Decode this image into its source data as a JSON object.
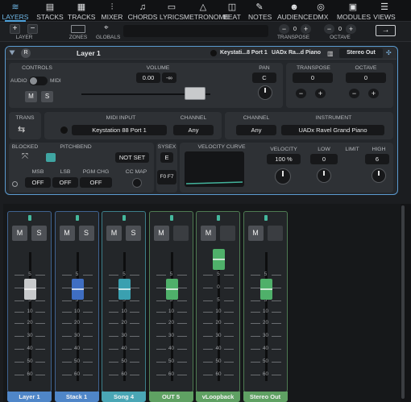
{
  "nav": [
    {
      "label": "LAYERS",
      "icon": "≋",
      "icon_name": "layers-icon",
      "active": true
    },
    {
      "label": "STACKS",
      "icon": "▤",
      "icon_name": "stacks-icon"
    },
    {
      "label": "TRACKS",
      "icon": "▦",
      "icon_name": "tracks-icon"
    },
    {
      "label": "MIXER",
      "icon": "⫶",
      "icon_name": "mixer-icon"
    },
    {
      "label": "CHORDS",
      "icon": "♫",
      "icon_name": "chords-icon"
    },
    {
      "label": "LYRICS",
      "icon": "▭",
      "icon_name": "lyrics-icon"
    },
    {
      "label": "METRONOME",
      "icon": "△",
      "icon_name": "metronome-icon"
    },
    {
      "label": "BEAT",
      "icon": "◫",
      "icon_name": "beat-icon"
    },
    {
      "label": "NOTES",
      "icon": "✎",
      "icon_name": "notes-icon"
    },
    {
      "label": "AUDIENCE",
      "icon": "☻",
      "icon_name": "audience-icon"
    },
    {
      "label": "DMX",
      "icon": "◎",
      "icon_name": "dmx-icon"
    },
    {
      "label": "MODULES",
      "icon": "▣",
      "icon_name": "modules-icon"
    },
    {
      "label": "VIEWS",
      "icon": "☰",
      "icon_name": "views-icon"
    }
  ],
  "toolbar": {
    "layer": "LAYER",
    "zones": "ZONES",
    "globals": "GLOBALS",
    "transpose": "TRANSPOSE",
    "transpose_value": "0",
    "octave": "OCTAVE",
    "octave_value": "0",
    "minus": "−",
    "plus": "+",
    "add": "+",
    "remove": "−",
    "next": "→"
  },
  "layer": {
    "r_badge": "R",
    "name": "Layer 1",
    "input_short": "Keystati...8 Port 1",
    "instrument_short": "UADx Ra...d Piano",
    "output": "Stereo Out",
    "controls_label": "CONTROLS",
    "audio": "AUDIO",
    "midi": "MIDI",
    "mute": "M",
    "solo": "S",
    "volume_label": "VOLUME",
    "volume_value": "0.00",
    "volume_inf": "-∞",
    "pan_label": "PAN",
    "pan_value": "C",
    "transpose_label": "TRANSPOSE",
    "transpose_value": "0",
    "octave_label": "OCTAVE",
    "octave_value": "0",
    "minus": "−",
    "plus": "+",
    "trans_label": "TRANS",
    "midi_input_label": "MIDI INPUT",
    "midi_input": "Keystation 88 Port 1",
    "channel_label": "CHANNEL",
    "channel_in": "Any",
    "channel_out": "Any",
    "instrument_label": "INSTRUMENT",
    "instrument": "UADx Ravel Grand Piano",
    "blocked_label": "BLOCKED",
    "pitchbend_label": "PITCHBEND",
    "pitchbend_value": "NOT SET",
    "sysex_label": "SYSEX",
    "sysex_value": "E",
    "velocity_curve_label": "VELOCITY CURVE",
    "velocity_label": "VELOCITY",
    "velocity_value": "100 %",
    "low_label": "LOW",
    "low_value": "0",
    "limit_label": "LIMIT",
    "high_label": "HIGH",
    "high_value": "6",
    "msb_label": "MSB",
    "msb": "OFF",
    "lsb_label": "LSB",
    "lsb": "OFF",
    "pgm_label": "PGM CHG",
    "pgm": "OFF",
    "ccmap_label": "CC MAP",
    "f0f7": "F0 F7"
  },
  "mixer": {
    "ticks": [
      "5",
      "0",
      "5",
      "10",
      "20",
      "30",
      "40",
      "50",
      "60"
    ],
    "strips": [
      {
        "name": "Layer 1",
        "m": "M",
        "s": "S",
        "has_solo": true,
        "color": "#4f86c8",
        "cap": "#c8cacc",
        "level": 0.83
      },
      {
        "name": "Stack 1",
        "m": "M",
        "s": "S",
        "has_solo": true,
        "color": "#4f86c8",
        "cap": "#3f6ec2",
        "level": 0.83
      },
      {
        "name": "Song 4",
        "m": "M",
        "s": "S",
        "has_solo": true,
        "color": "#4aa6b5",
        "cap": "#3aa0b0",
        "level": 0.83
      },
      {
        "name": "OUT 5",
        "m": "M",
        "s": "",
        "has_solo": false,
        "color": "#5fa163",
        "cap": "#4fb06a",
        "level": 0.83
      },
      {
        "name": "vLoopback",
        "m": "M",
        "s": "",
        "has_solo": false,
        "color": "#5fa163",
        "cap": "#4fb06a",
        "level": 0.98
      },
      {
        "name": "Stereo Out",
        "m": "M",
        "s": "",
        "has_solo": false,
        "color": "#5fa163",
        "cap": "#4fb06a",
        "level": 0.83
      }
    ]
  }
}
